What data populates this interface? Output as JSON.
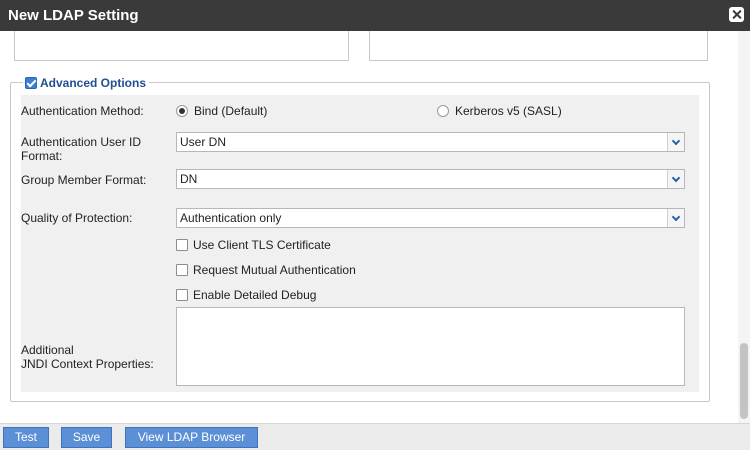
{
  "window": {
    "title": "New LDAP Setting"
  },
  "advanced": {
    "legend": "Advanced Options",
    "checked": true,
    "auth_method": {
      "label": "Authentication Method:",
      "options": [
        {
          "label": "Bind (Default)",
          "selected": true
        },
        {
          "label": "Kerberos v5 (SASL)",
          "selected": false
        }
      ]
    },
    "user_id_format": {
      "label_line1": "Authentication User ID",
      "label_line2": "Format:",
      "value": "User DN"
    },
    "group_member_format": {
      "label": "Group Member Format:",
      "value": "DN"
    },
    "qop": {
      "label": "Quality of Protection:",
      "value": "Authentication only"
    },
    "checkboxes": [
      {
        "label": "Use Client TLS Certificate",
        "checked": false
      },
      {
        "label": "Request Mutual Authentication",
        "checked": false
      },
      {
        "label": "Enable Detailed Debug",
        "checked": false
      }
    ],
    "jndi": {
      "label_line1": "Additional",
      "label_line2": "JNDI Context Properties:",
      "value": ""
    }
  },
  "footer": {
    "test_label": "Test",
    "save_label": "Save",
    "browser_label": "View LDAP Browser"
  }
}
